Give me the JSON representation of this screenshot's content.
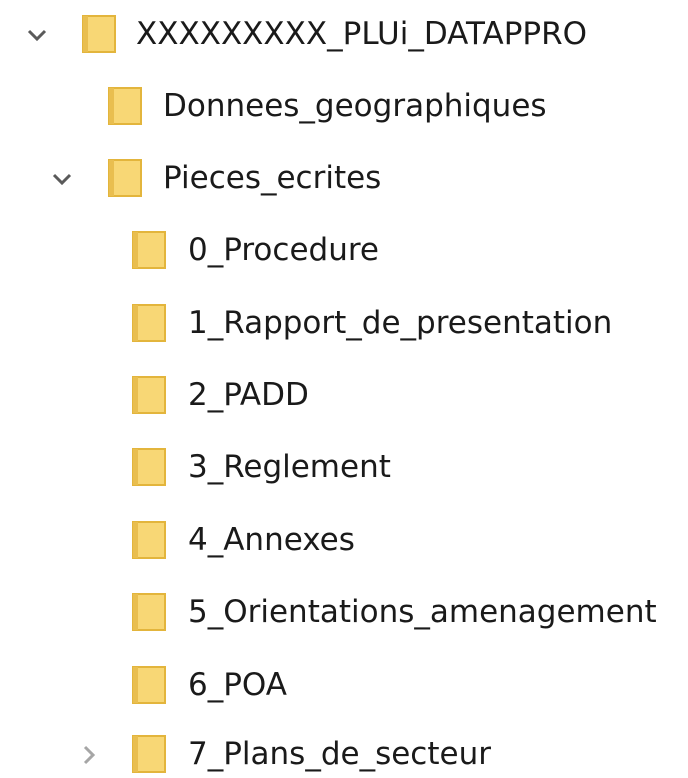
{
  "tree": {
    "root": {
      "label": "XXXXXXXXX_PLUi_DATAPPRO",
      "expanded": true
    },
    "donnees": {
      "label": "Donnees_geographiques"
    },
    "pieces": {
      "label": "Pieces_ecrites",
      "expanded": true,
      "children": [
        {
          "label": "0_Procedure"
        },
        {
          "label": "1_Rapport_de_presentation"
        },
        {
          "label": "2_PADD"
        },
        {
          "label": "3_Reglement"
        },
        {
          "label": "4_Annexes"
        },
        {
          "label": "5_Orientations_amenagement"
        },
        {
          "label": "6_POA"
        },
        {
          "label": "7_Plans_de_secteur",
          "expanded": false
        }
      ]
    }
  },
  "icons": {
    "folder": "folder-icon",
    "expanded": "chevron-down-icon",
    "collapsed": "chevron-right-icon"
  },
  "colors": {
    "folder_body": "#f8d775",
    "folder_edge": "#e3b53c",
    "folder_tab": "#e9be4f",
    "chevron": "#5a5a5a",
    "chevron_collapsed": "#a6a6a6",
    "text": "#1a1a1a"
  }
}
